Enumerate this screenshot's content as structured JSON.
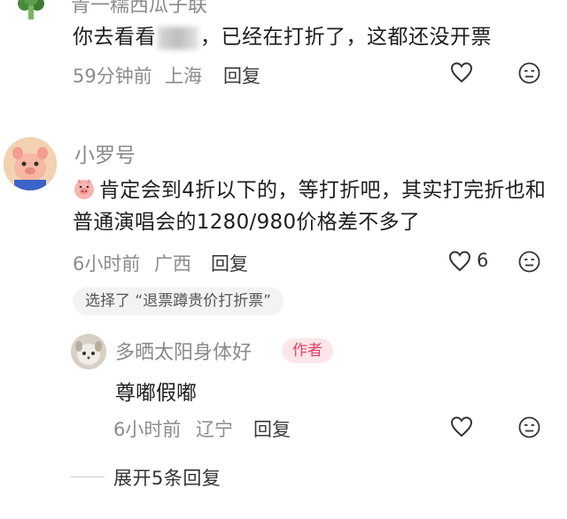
{
  "comment1": {
    "author_partial": "青一糯西瓜子联",
    "text_before": "你去看看",
    "text_after": "，已经在打折了，这都还没开票",
    "time": "59分钟前",
    "location": "上海",
    "reply_label": "回复"
  },
  "comment2": {
    "author": "小罗号",
    "text": "肯定会到4折以下的，等打折吧，其实打完折也和普通演唱会的1280/980价格差不多了",
    "time": "6小时前",
    "location": "广西",
    "reply_label": "回复",
    "like_count": "6",
    "selected_tag": "选择了 “退票蹲贵价打折票”"
  },
  "reply1": {
    "author": "多晒太阳身体好",
    "badge": "作者",
    "text": "尊嘟假嘟",
    "time": "6小时前",
    "location": "辽宁",
    "reply_label": "回复"
  },
  "expand_label": "展开5条回复",
  "icons": {
    "like": "heart-outline-icon",
    "dislike": "meh-face-icon",
    "emoji": "pig-emoji-icon"
  },
  "colors": {
    "text": "#1e1e1e",
    "meta": "#8c8c8c",
    "author_badge_bg": "#fde6ea",
    "author_badge_text": "#ea3f63",
    "tag_bg": "#f3f3f3"
  }
}
